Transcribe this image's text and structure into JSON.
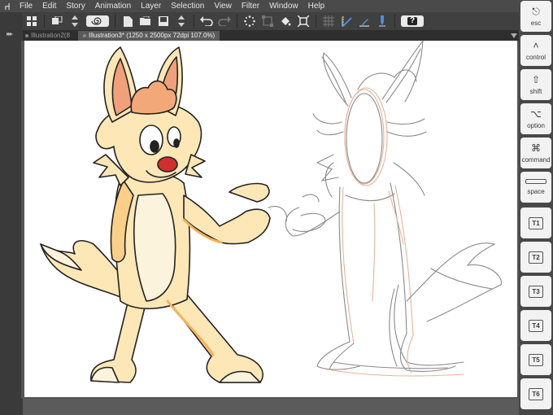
{
  "app": {
    "logo_glyph": "⑁"
  },
  "menu": [
    "File",
    "Edit",
    "Story",
    "Animation",
    "Layer",
    "Selection",
    "View",
    "Filter",
    "Window",
    "Help"
  ],
  "toolbar": {
    "icons": [
      "grid-icon",
      "color-swap-icon",
      "up-down-stepper-icon",
      "spiral-brush-icon",
      "new-file-icon",
      "open-folder-icon",
      "save-icon",
      "undo-icon",
      "redo-icon",
      "sparkle-icon",
      "transform-icon",
      "fill-icon",
      "crop-icon",
      "snap-grid-icon",
      "ruler-icon",
      "edit-ruler-icon",
      "pen-pressure-icon",
      "help-icon"
    ],
    "help_label": "?"
  },
  "tabs": [
    {
      "label": "Illustration2(8",
      "active": false
    },
    {
      "label": "Illustration3* (1250 x 2500px 72dpi 107.0%)",
      "active": true
    }
  ],
  "side_keys": [
    {
      "glyph": "⎋",
      "label": "esc"
    },
    {
      "glyph": "˄",
      "label": "control"
    },
    {
      "glyph": "⇧",
      "label": "shift"
    },
    {
      "glyph": "⌥",
      "label": "option"
    },
    {
      "glyph": "⌘",
      "label": "command"
    },
    {
      "glyph": "",
      "label": "space"
    },
    {
      "glyph": "",
      "label": "T1"
    },
    {
      "glyph": "",
      "label": "T2"
    },
    {
      "glyph": "",
      "label": "T3"
    },
    {
      "glyph": "",
      "label": "T4"
    },
    {
      "glyph": "",
      "label": "T5"
    },
    {
      "glyph": "",
      "label": "T6"
    }
  ],
  "colors": {
    "fur_light": "#fde7b6",
    "fur_mid": "#f9cf8a",
    "fur_shadow": "#f5b25a",
    "ear_inner": "#f0a07a",
    "nose": "#cf2f2f",
    "sketch_gray": "#8a8a8a",
    "sketch_orange": "#e8b49a"
  }
}
